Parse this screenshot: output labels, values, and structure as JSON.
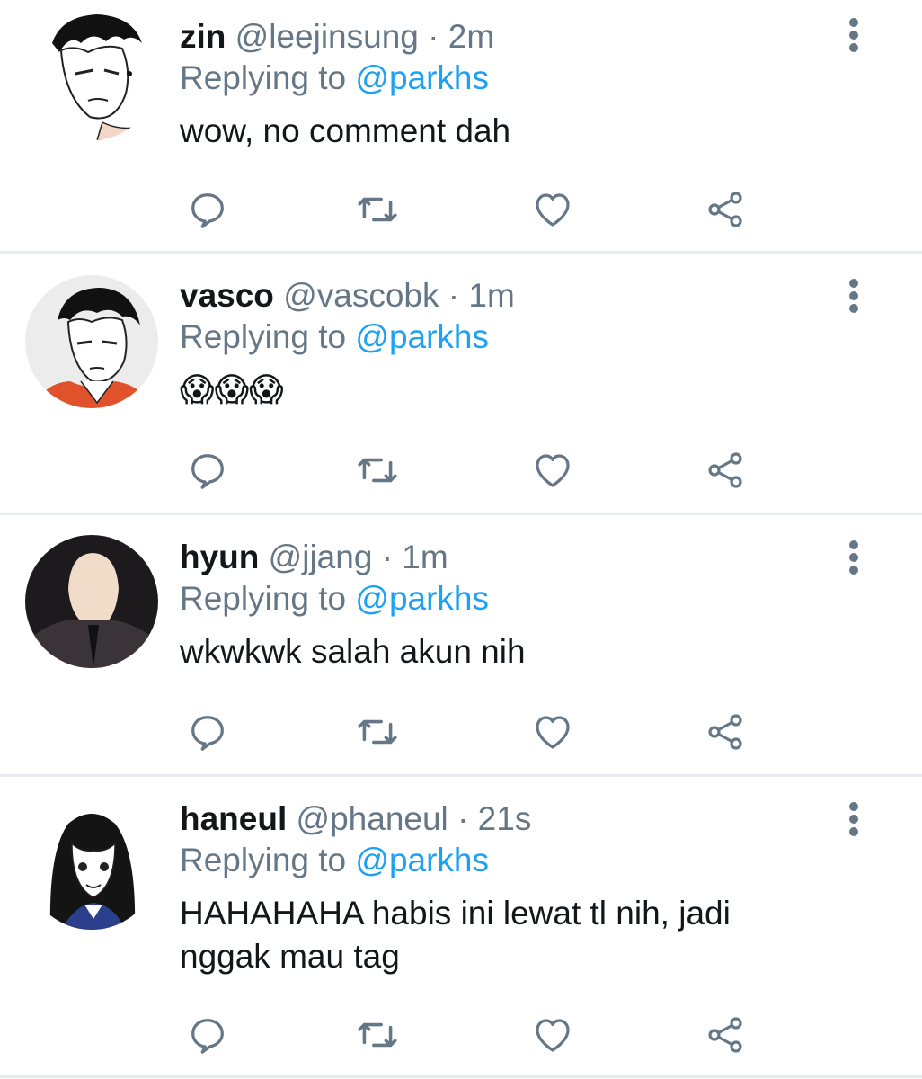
{
  "tweets": [
    {
      "name": "zin",
      "handle": "@leejinsung",
      "separator": "·",
      "time": "2m",
      "replying_label": "Replying to",
      "replying_to": "@parkhs",
      "text": "wow, no comment dah"
    },
    {
      "name": "vasco",
      "handle": "@vascobk",
      "separator": "·",
      "time": "1m",
      "replying_label": "Replying to",
      "replying_to": "@parkhs",
      "text": "😱😱😱"
    },
    {
      "name": "hyun",
      "handle": "@jjang",
      "separator": "·",
      "time": "1m",
      "replying_label": "Replying to",
      "replying_to": "@parkhs",
      "text": "wkwkwk salah akun nih"
    },
    {
      "name": "haneul",
      "handle": "@phaneul",
      "separator": "·",
      "time": "21s",
      "replying_label": "Replying to",
      "replying_to": "@parkhs",
      "text": "HAHAHAHA habis ini lewat tl nih, jadi nggak mau tag"
    }
  ],
  "icons": {
    "reply": "reply-icon",
    "retweet": "retweet-icon",
    "like": "heart-icon",
    "share": "share-icon",
    "more": "more-vertical-icon"
  },
  "colors": {
    "text": "#14171a",
    "secondary": "#657786",
    "link": "#1da1f2",
    "icon": "#657786",
    "divider": "#e6ecf0"
  }
}
